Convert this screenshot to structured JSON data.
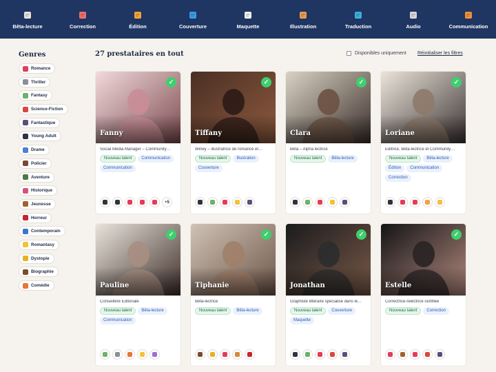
{
  "nav": [
    {
      "label": "Bêta-lecture",
      "icon": "glasses-icon",
      "color": "#e9e4dc"
    },
    {
      "label": "Correction",
      "icon": "notepad-icon",
      "color": "#ef6f6f"
    },
    {
      "label": "Édition",
      "icon": "writing-hand-icon",
      "color": "#f2a33b"
    },
    {
      "label": "Couverture",
      "icon": "book-icon",
      "color": "#3a9be8"
    },
    {
      "label": "Maquette",
      "icon": "page-icon",
      "color": "#f1f1f1"
    },
    {
      "label": "Illustration",
      "icon": "palette-icon",
      "color": "#e89d52"
    },
    {
      "label": "Traduction",
      "icon": "globe-icon",
      "color": "#39b3d6"
    },
    {
      "label": "Audio",
      "icon": "headphones-icon",
      "color": "#d7d7d7"
    },
    {
      "label": "Communication",
      "icon": "megaphone-icon",
      "color": "#f0903a"
    }
  ],
  "sidebar": {
    "title": "Genres",
    "genres": [
      {
        "label": "Romance",
        "icon": "heart-icon",
        "color": "#e43b5b"
      },
      {
        "label": "Thriller",
        "icon": "knife-icon",
        "color": "#8b8f96"
      },
      {
        "label": "Fantasy",
        "icon": "unicorn-icon",
        "color": "#6cb36b"
      },
      {
        "label": "Science-Fiction",
        "icon": "rocket-icon",
        "color": "#d9473f"
      },
      {
        "label": "Fantastique",
        "icon": "crystal-ball-icon",
        "color": "#5a4e7a"
      },
      {
        "label": "Young Adult",
        "icon": "teen-icon",
        "color": "#2e3340"
      },
      {
        "label": "Drame",
        "icon": "drama-mask-icon",
        "color": "#4b7fd1"
      },
      {
        "label": "Policier",
        "icon": "detective-icon",
        "color": "#7a4a2f"
      },
      {
        "label": "Aventure",
        "icon": "mountain-icon",
        "color": "#4d7a44"
      },
      {
        "label": "Historique",
        "icon": "castle-icon",
        "color": "#d6537b"
      },
      {
        "label": "Jeunesse",
        "icon": "teddy-icon",
        "color": "#a0622d"
      },
      {
        "label": "Horreur",
        "icon": "drop-icon",
        "color": "#c9232e"
      },
      {
        "label": "Contemporain",
        "icon": "city-icon",
        "color": "#3b77c8"
      },
      {
        "label": "Romantasy",
        "icon": "sparkle-moon-icon",
        "color": "#f2c23a"
      },
      {
        "label": "Dystopie",
        "icon": "radioactive-icon",
        "color": "#e7b21f"
      },
      {
        "label": "Biographie",
        "icon": "books-icon",
        "color": "#7b4b2a"
      },
      {
        "label": "Comédie",
        "icon": "laugh-icon",
        "color": "#e8743b"
      }
    ]
  },
  "results_title": "27 prestataires en tout",
  "available_label": "Disponibles uniquement",
  "reset_label": "Réinitialiser les filtres",
  "cards": [
    {
      "name": "Fanny",
      "desc": "Social Média Manager – Community…",
      "tags": [
        {
          "label": "Nouveau talent",
          "kind": "new"
        },
        {
          "label": "Communication",
          "kind": "skill"
        },
        {
          "label": "Communication",
          "kind": "skill"
        }
      ],
      "emojis": [
        "#2e3340",
        "#2e3340",
        "#e43b5b",
        "#e43b5b",
        "#e43b5b"
      ],
      "more": "+5",
      "bg": [
        "#f1d9da",
        "#c98d97",
        "#7b4a4f"
      ]
    },
    {
      "name": "Tiffany",
      "desc": "Winey – illustratrice de romance et…",
      "tags": [
        {
          "label": "Nouveau talent",
          "kind": "new"
        },
        {
          "label": "Illustration",
          "kind": "skill"
        },
        {
          "label": "Couverture",
          "kind": "skill"
        }
      ],
      "emojis": [
        "#2e3340",
        "#6cb36b",
        "#e43b5b",
        "#f2c23a",
        "#5a4e7a"
      ],
      "more": "",
      "bg": [
        "#4a2f24",
        "#2b1b17",
        "#8e5a3e"
      ]
    },
    {
      "name": "Clara",
      "desc": "Bêta – Alpha lectrice",
      "tags": [
        {
          "label": "Nouveau talent",
          "kind": "new"
        },
        {
          "label": "Bêta-lecture",
          "kind": "skill"
        }
      ],
      "emojis": [
        "#2e3340",
        "#6cb36b",
        "#e43b5b",
        "#f2c23a",
        "#5a4e7a"
      ],
      "more": "",
      "bg": [
        "#d9d2c4",
        "#6b5142",
        "#3a2e2a"
      ]
    },
    {
      "name": "Loriane",
      "desc": "Éditrice, Bêta-lectrice et Community…",
      "tags": [
        {
          "label": "Nouveau talent",
          "kind": "new"
        },
        {
          "label": "Bêta-lecture",
          "kind": "skill"
        },
        {
          "label": "Édition",
          "kind": "skill"
        },
        {
          "label": "Communication",
          "kind": "skill"
        },
        {
          "label": "Correction",
          "kind": "skill"
        }
      ],
      "emojis": [
        "#2e3340",
        "#e43b5b",
        "#e43b5b",
        "#f2a33b",
        "#f2c23a"
      ],
      "more": "",
      "bg": [
        "#ebe4da",
        "#8e7a6a",
        "#3c3434"
      ]
    },
    {
      "name": "Pauline",
      "desc": "Conseillère Éditoriale",
      "tags": [
        {
          "label": "Nouveau talent",
          "kind": "new"
        },
        {
          "label": "Bêta-lecture",
          "kind": "skill"
        },
        {
          "label": "Communication",
          "kind": "skill"
        }
      ],
      "emojis": [
        "#6cb36b",
        "#8b8f96",
        "#e8743b",
        "#f2c23a",
        "#9a6fd1"
      ],
      "more": "",
      "bg": [
        "#e9e3dc",
        "#a78e82",
        "#3f2f2a"
      ]
    },
    {
      "name": "Tiphanie",
      "desc": "Bêta-lectrice",
      "tags": [
        {
          "label": "Nouveau talent",
          "kind": "new"
        },
        {
          "label": "Bêta-lecture",
          "kind": "skill"
        }
      ],
      "emojis": [
        "#7a4a2f",
        "#e7b21f",
        "#e43b5b",
        "#d58a3b",
        "#c9232e"
      ],
      "more": "",
      "bg": [
        "#cfc2b6",
        "#a07f69",
        "#6e5548"
      ]
    },
    {
      "name": "Jonathan",
      "desc": "Graphiste littéraire spécialisé dans le…",
      "tags": [
        {
          "label": "Nouveau talent",
          "kind": "new"
        },
        {
          "label": "Couverture",
          "kind": "skill"
        },
        {
          "label": "Maquette",
          "kind": "skill"
        }
      ],
      "emojis": [
        "#2e3340",
        "#6cb36b",
        "#e43b5b",
        "#d9473f",
        "#5a4e7a"
      ],
      "more": "",
      "bg": [
        "#1b1b1d",
        "#2c2c2e",
        "#7a5a48"
      ]
    },
    {
      "name": "Estelle",
      "desc": "Correctrice-relectrice certifiée",
      "tags": [
        {
          "label": "Nouveau talent",
          "kind": "new"
        },
        {
          "label": "Correction",
          "kind": "skill"
        }
      ],
      "emojis": [
        "#e43b5b",
        "#a0622d",
        "#e43b5b",
        "#d9473f",
        "#5a4e7a"
      ],
      "more": "",
      "bg": [
        "#141416",
        "#2a2224",
        "#b38a7e"
      ]
    }
  ]
}
